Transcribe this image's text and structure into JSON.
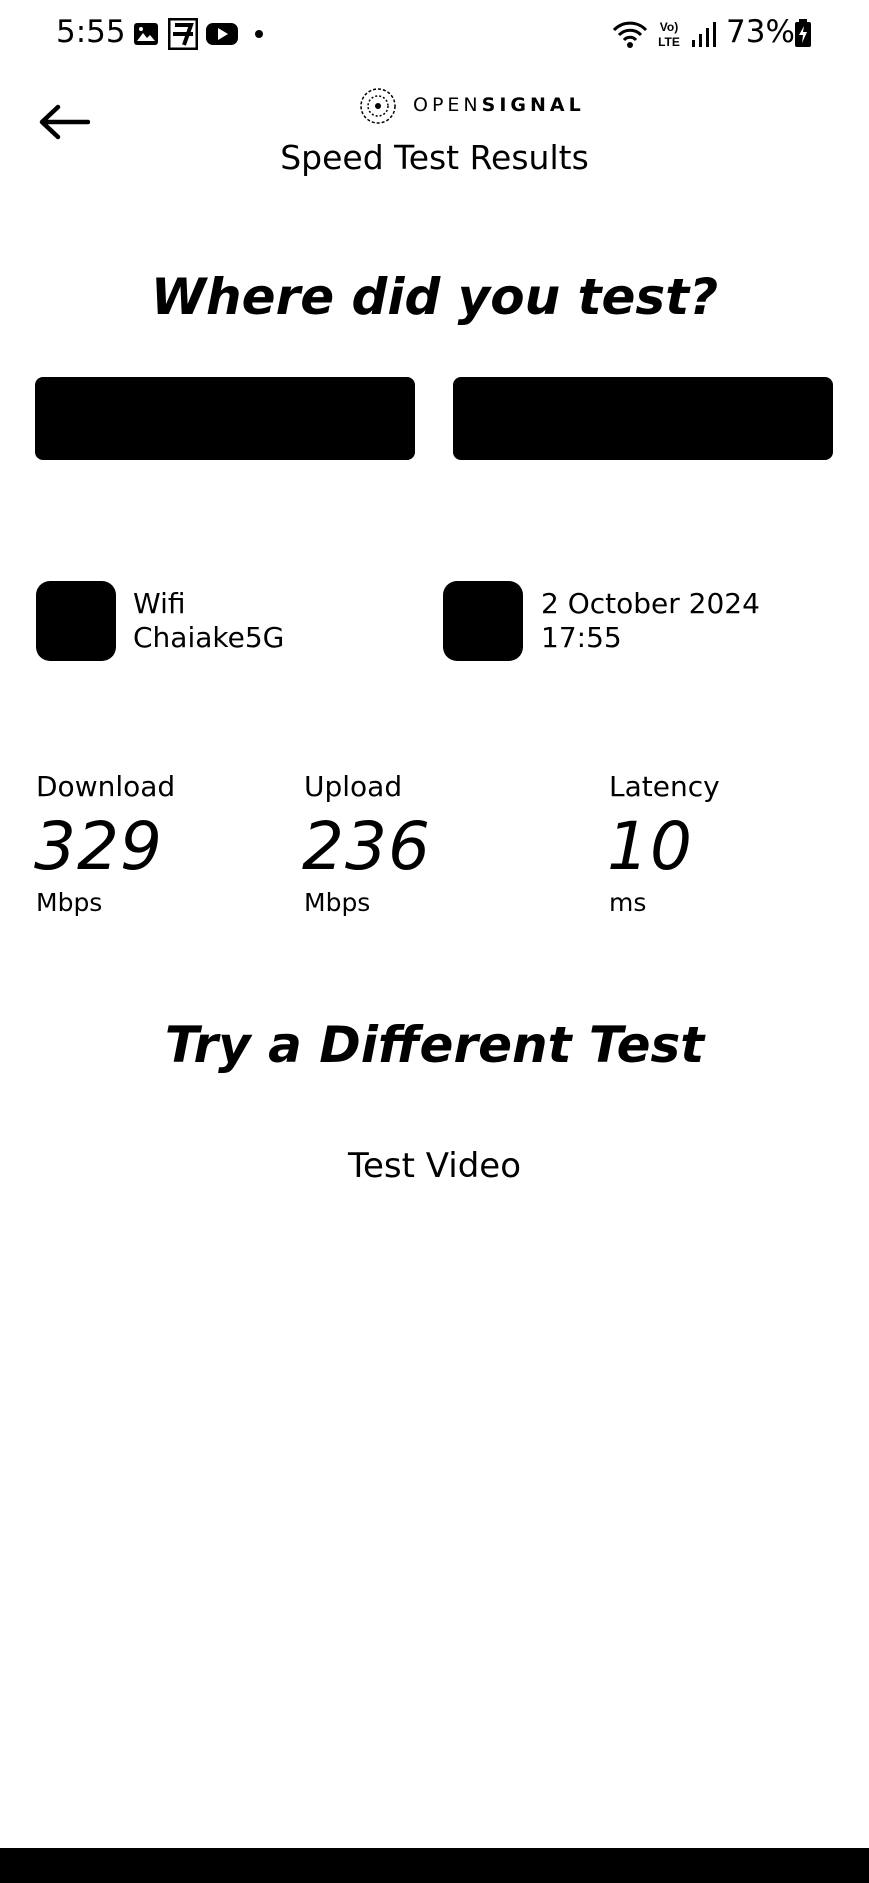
{
  "status_bar": {
    "time": "5:55",
    "left_icons": [
      "gallery-icon",
      "seven-eleven-icon",
      "youtube-icon",
      "dot-icon"
    ],
    "right_icons": [
      "wifi-icon",
      "volte-icon",
      "signal-icon",
      "battery-icon"
    ],
    "battery_percent": "73%"
  },
  "header": {
    "back_icon": "arrow-left-icon",
    "brand_prefix": "OPEN",
    "brand_suffix": "SIGNAL",
    "title": "Speed Test Results"
  },
  "location": {
    "heading": "Where did you test?"
  },
  "details": {
    "connection_type": "Wifi",
    "network_name": "Chaiake5G",
    "date": "2 October 2024",
    "time": "17:55"
  },
  "metrics": {
    "download": {
      "label": "Download",
      "value": "329",
      "unit": "Mbps"
    },
    "upload": {
      "label": "Upload",
      "value": "236",
      "unit": "Mbps"
    },
    "latency": {
      "label": "Latency",
      "value": "10",
      "unit": "ms"
    }
  },
  "other_tests": {
    "heading": "Try a Different Test",
    "video_label": "Test Video"
  },
  "colors": {
    "background": "#ffffff",
    "foreground": "#000000"
  }
}
